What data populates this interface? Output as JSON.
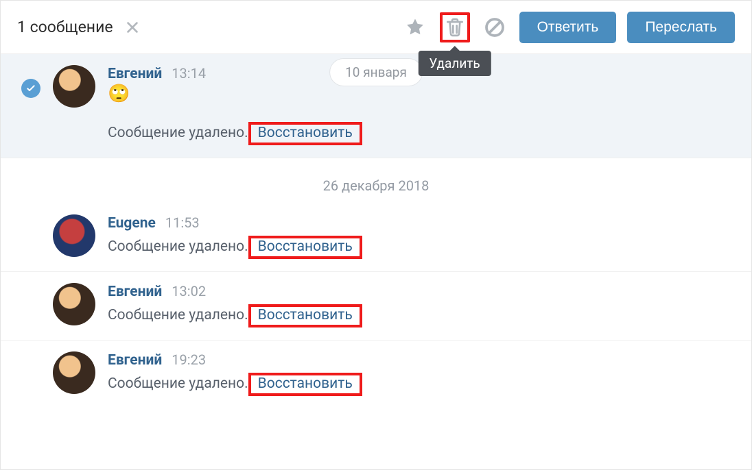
{
  "topbar": {
    "selection_count": "1 сообщение",
    "delete_tooltip": "Удалить",
    "reply_label": "Ответить",
    "forward_label": "Переслать"
  },
  "date_chip": "10 января",
  "date_separator": "26 декабря 2018",
  "deleted_text": "Сообщение удалено.",
  "restore_text": "Восстановить",
  "messages": [
    {
      "name": "Евгений",
      "time": "13:14",
      "avatar": "a1",
      "selected": true,
      "has_emoji": true,
      "show_deleted": true
    },
    {
      "name": "Eugene",
      "time": "11:53",
      "avatar": "a2",
      "selected": false,
      "has_emoji": false,
      "show_deleted": true
    },
    {
      "name": "Евгений",
      "time": "13:02",
      "avatar": "a1",
      "selected": false,
      "has_emoji": false,
      "show_deleted": true
    },
    {
      "name": "Евгений",
      "time": "19:23",
      "avatar": "a1",
      "selected": false,
      "has_emoji": false,
      "show_deleted": true
    }
  ]
}
